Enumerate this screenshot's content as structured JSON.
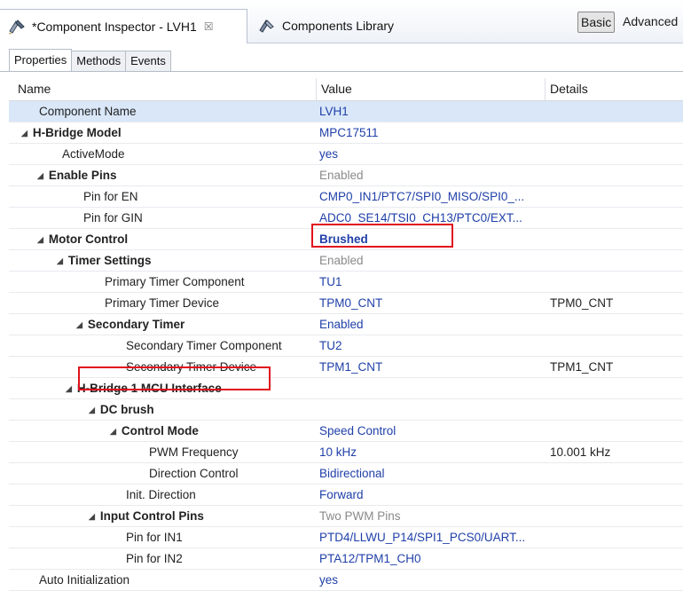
{
  "editor_tabs": [
    {
      "label": "*Component Inspector - LVH1",
      "close": "☒"
    },
    {
      "label": "Components Library"
    }
  ],
  "view_modes": {
    "basic": "Basic",
    "advanced": "Advanced"
  },
  "inspector_tabs": [
    "Properties",
    "Methods",
    "Events"
  ],
  "columns": {
    "name": "Name",
    "value": "Value",
    "details": "Details"
  },
  "rows": [
    {
      "name": "Component Name",
      "value": "LVH1",
      "details": ""
    },
    {
      "name": "H-Bridge Model",
      "value": "MPC17511",
      "details": ""
    },
    {
      "name": "ActiveMode",
      "value": "yes",
      "details": ""
    },
    {
      "name": "Enable Pins",
      "value": "Enabled",
      "details": ""
    },
    {
      "name": "Pin for EN",
      "value": "CMP0_IN1/PTC7/SPI0_MISO/SPI0_...",
      "details": ""
    },
    {
      "name": "Pin for GIN",
      "value": "ADC0_SE14/TSI0_CH13/PTC0/EXT...",
      "details": ""
    },
    {
      "name": "Motor Control",
      "value": "Brushed",
      "details": ""
    },
    {
      "name": "Timer Settings",
      "value": "Enabled",
      "details": ""
    },
    {
      "name": "Primary Timer Component",
      "value": "TU1",
      "details": ""
    },
    {
      "name": "Primary Timer Device",
      "value": "TPM0_CNT",
      "details": "TPM0_CNT"
    },
    {
      "name": "Secondary Timer",
      "value": "Enabled",
      "details": ""
    },
    {
      "name": "Secondary Timer Component",
      "value": "TU2",
      "details": ""
    },
    {
      "name": "Secondary Timer Device",
      "value": "TPM1_CNT",
      "details": "TPM1_CNT"
    },
    {
      "name": "H-Bridge 1 MCU Interface",
      "value": "",
      "details": ""
    },
    {
      "name": "DC brush",
      "value": "",
      "details": ""
    },
    {
      "name": "Control Mode",
      "value": "Speed Control",
      "details": ""
    },
    {
      "name": "PWM Frequency",
      "value": "10 kHz",
      "details": "10.001 kHz"
    },
    {
      "name": "Direction Control",
      "value": "Bidirectional",
      "details": ""
    },
    {
      "name": "Init. Direction",
      "value": "Forward",
      "details": ""
    },
    {
      "name": "Input Control Pins",
      "value": "Two PWM Pins",
      "details": ""
    },
    {
      "name": "Pin for IN1",
      "value": "PTD4/LLWU_P14/SPI1_PCS0/UART...",
      "details": ""
    },
    {
      "name": "Pin for IN2",
      "value": "PTA12/TPM1_CH0",
      "details": ""
    },
    {
      "name": "Auto Initialization",
      "value": "yes",
      "details": ""
    }
  ],
  "colors": {
    "value_text": "#1f3fa8",
    "grey_value": "#8a8a8a",
    "selection": "#d9e7f8",
    "highlight_box": "#e0101b"
  }
}
